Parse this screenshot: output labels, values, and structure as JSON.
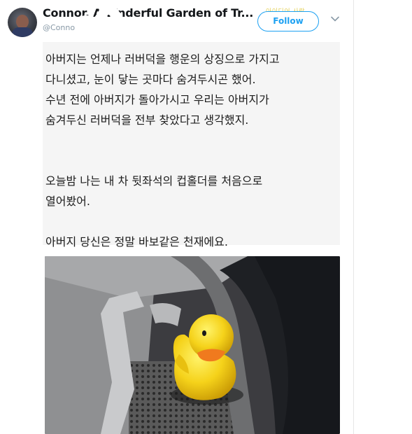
{
  "tweet": {
    "author_name": "Connor, A W",
    "author_name_rest": "Garden of Tr...",
    "author_name_obscured": "nderful",
    "handle_visible": "@Conno",
    "watermark": "아이디어 사랑",
    "follow_label": "Follow",
    "lines": [
      "아버지는 언제나 러버덕을 행운의 상징으로 가지고",
      "다니셨고, 눈이 닿는 곳마다 숨겨두시곤 했어.",
      "수년 전에 아버지가 돌아가시고 우리는 아버지가",
      "숨겨두신 러버덕을 전부 찾았다고 생각했지.",
      "오늘밤 나는 내 차 뒷좌석의 컵홀더를 처음으로",
      "열어봤어.",
      "아버지 당신은 정말 바보같은 천재에요."
    ]
  },
  "photo": {
    "subject": "rubber duck in car cupholder",
    "duck_color": "#f5d21a",
    "beak_color": "#f07a1e"
  },
  "colors": {
    "follow_blue": "#1da1f2",
    "name": "#14171a",
    "handle": "#8899a6"
  }
}
